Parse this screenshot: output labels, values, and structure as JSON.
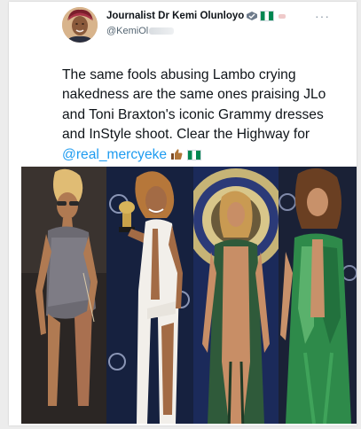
{
  "tweet": {
    "display_name": "Journalist Dr Kemi Olunloyo",
    "handle": "@KemiOl",
    "text_before_mention": "The same fools abusing Lambo crying nakedness are the same ones  praising JLo and Toni Braxton's iconic Grammy dresses and InStyle shoot. Clear the Highway for ",
    "mention": "@real_mercyeke",
    "badge_icons": [
      "verified-badge-icon",
      "nigeria-flag-icon"
    ],
    "end_icons": [
      "thumbs-up-icon",
      "nigeria-flag-icon"
    ],
    "more_icon": "more-options-icon"
  },
  "colors": {
    "mention": "#1d9bf0",
    "text": "#0f1419",
    "secondary": "#536471",
    "flag_green": "#008751"
  }
}
